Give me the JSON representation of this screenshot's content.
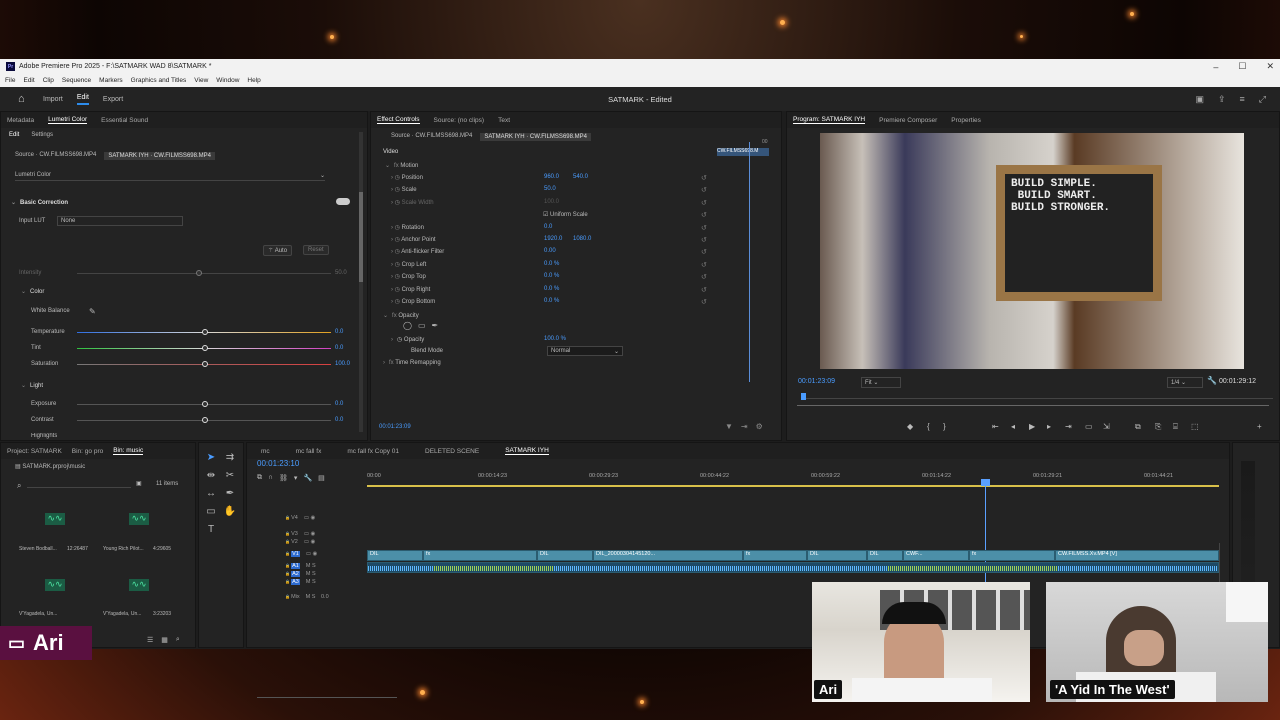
{
  "window": {
    "title": "Adobe Premiere Pro 2025 - F:\\SATMARK WAD 8\\SATMARK *",
    "controls": [
      "–",
      "☐",
      "✕"
    ]
  },
  "menu": [
    "File",
    "Edit",
    "Clip",
    "Sequence",
    "Markers",
    "Graphics and Titles",
    "View",
    "Window",
    "Help"
  ],
  "appbar": {
    "tabs": [
      "Import",
      "Edit",
      "Export"
    ],
    "active": "Edit",
    "project_title": "SATMARK - Edited"
  },
  "lumetri": {
    "tabs": [
      "Metadata",
      "Lumetri Color",
      "Essential Sound"
    ],
    "subtabs": [
      "Edit",
      "Settings"
    ],
    "source_tab": "Source · CW.FILMSS698.MP4",
    "seq_tab": "SATMARK IYH · CW.FILMSS698.MP4",
    "effect": "Lumetri Color",
    "section": "Basic Correction",
    "input_lut_label": "Input LUT",
    "input_lut_value": "None",
    "auto": "Auto",
    "reset": "Reset",
    "intensity": "Intensity",
    "intensity_value": "50.0",
    "color_section": "Color",
    "white_balance": "White Balance",
    "temperature": "Temperature",
    "temperature_value": "0.0",
    "tint": "Tint",
    "tint_value": "0.0",
    "saturation": "Saturation",
    "saturation_value": "100.0",
    "light_section": "Light",
    "exposure": "Exposure",
    "exposure_value": "0.0",
    "contrast": "Contrast",
    "contrast_value": "0.0",
    "highlights": "Highlights"
  },
  "effects": {
    "tabs": [
      "Effect Controls",
      "Source: (no clips)",
      "Text"
    ],
    "source_tab": "Source · CW.FILMSS698.MP4",
    "seq_tab": "SATMARK IYH · CW.FILMSS698.MP4",
    "clip_label": "CW.FILMSS698.M",
    "time_mark": "00",
    "video": "Video",
    "motion": "Motion",
    "props": [
      {
        "name": "Position",
        "v1": "960.0",
        "v2": "540.0"
      },
      {
        "name": "Scale",
        "v1": "50.0",
        "v2": ""
      },
      {
        "name": "Scale Width",
        "v1": "100.0",
        "v2": ""
      },
      {
        "name": "Uniform Scale",
        "v1": "",
        "v2": ""
      },
      {
        "name": "Rotation",
        "v1": "0.0",
        "v2": ""
      },
      {
        "name": "Anchor Point",
        "v1": "1920.0",
        "v2": "1080.0"
      },
      {
        "name": "Anti-flicker Filter",
        "v1": "0.00",
        "v2": ""
      },
      {
        "name": "Crop Left",
        "v1": "0.0 %",
        "v2": ""
      },
      {
        "name": "Crop Top",
        "v1": "0.0 %",
        "v2": ""
      },
      {
        "name": "Crop Right",
        "v1": "0.0 %",
        "v2": ""
      },
      {
        "name": "Crop Bottom",
        "v1": "0.0 %",
        "v2": ""
      }
    ],
    "opacity_section": "Opacity",
    "opacity": "Opacity",
    "opacity_value": "100.0 %",
    "blend": "Blend Mode",
    "blend_value": "Normal",
    "time_remap": "Time Remapping",
    "timecode": "00:01:23:09"
  },
  "program": {
    "tabs": [
      "Program: SATMARK IYH",
      "Premiere Composer",
      "Properties"
    ],
    "sign_text": "BUILD SIMPLE.\n BUILD SMART.\nBUILD STRONGER.",
    "timecode": "00:01:23:09",
    "fit": "Fit",
    "quality": "1/4",
    "duration": "00:01:29:12"
  },
  "project": {
    "tabs": [
      "Project: SATMARK",
      "Bin: go pro",
      "Bin: music"
    ],
    "folder": "SATMARK.prproj\\music",
    "count": "11 items",
    "items": [
      {
        "name": "Steven Bodball...",
        "dur": "12:26487"
      },
      {
        "name": "Young Rich Pilot...",
        "dur": "4:29605"
      },
      {
        "name": "V'Yagadela, Un...",
        "dur": ""
      },
      {
        "name": "V'Yagadela, Un...",
        "dur": "3:23203"
      }
    ]
  },
  "timeline": {
    "tabs": [
      "mc",
      "mc fall fx",
      "mc fall fx Copy 01",
      "DELETED SCENE",
      "SATMARK IYH"
    ],
    "timecode": "00:01:23:10",
    "ruler": [
      "00:00",
      "00:00:14:23",
      "00:00:29:23",
      "00:00:44:22",
      "00:00:59:22",
      "00:01:14:22",
      "00:01:29:21",
      "00:01:44:21"
    ],
    "tracks": [
      "V4",
      "V3",
      "V2",
      "V1",
      "A1",
      "A2",
      "A3",
      "Mix"
    ],
    "mix_value": "0.0",
    "clips": [
      "DIL",
      "DIL",
      "DIL_20000304145120...",
      "DIL",
      "DIL",
      "CWF...",
      "CW.FILMSS.Xv.MP4 [V]"
    ]
  },
  "webcams": [
    {
      "name": "Ari"
    },
    {
      "name": "'A Yid In The West'"
    }
  ],
  "presenter": {
    "label": "Ari"
  }
}
